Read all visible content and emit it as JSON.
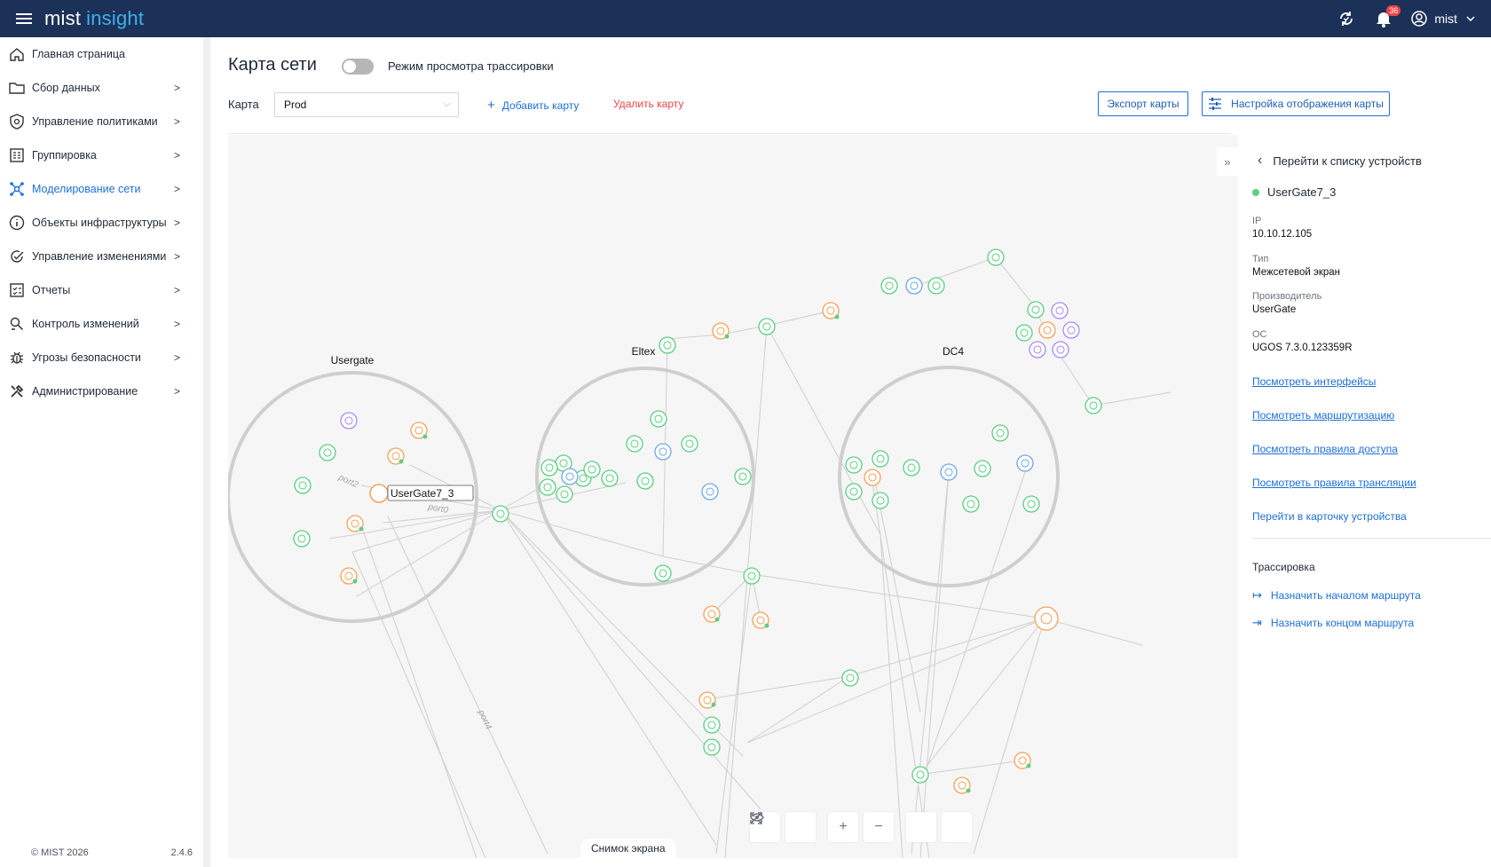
{
  "app": {
    "logo_main": "mist",
    "logo_accent": "insight",
    "notifications_count": "36",
    "user_name": "mist"
  },
  "sidebar": {
    "items": [
      {
        "label": "Главная страница",
        "icon": "home-icon",
        "chevron": ""
      },
      {
        "label": "Сбор данных",
        "icon": "folder-icon",
        "chevron": ">"
      },
      {
        "label": "Управление политиками",
        "icon": "shield-icon",
        "chevron": ">"
      },
      {
        "label": "Группировка",
        "icon": "grouping-icon",
        "chevron": ">"
      },
      {
        "label": "Моделирование сети",
        "icon": "network-icon",
        "chevron": ">"
      },
      {
        "label": "Объекты инфраструктуры",
        "icon": "info-icon",
        "chevron": ">"
      },
      {
        "label": "Управление изменениями",
        "icon": "check-circle-icon",
        "chevron": ">"
      },
      {
        "label": "Отчеты",
        "icon": "report-icon",
        "chevron": ">"
      },
      {
        "label": "Контроль изменений",
        "icon": "control-icon",
        "chevron": ">"
      },
      {
        "label": "Угрозы безопасности",
        "icon": "bug-icon",
        "chevron": ">"
      },
      {
        "label": "Администрирование",
        "icon": "tools-icon",
        "chevron": ">"
      }
    ],
    "copyright": "© MIST 2026",
    "version": "2.4.6"
  },
  "header": {
    "title": "Карта сети",
    "trace_toggle_label": "Режим просмотра трассировки",
    "map_label": "Карта",
    "map_selected": "Prod",
    "add_map": "Добавить карту",
    "delete_map": "Удалить карту",
    "export_map": "Экспорт карты",
    "map_settings": "Настройка отображения карты"
  },
  "map": {
    "groups": [
      "Usergate",
      "Eltex",
      "DC4"
    ],
    "selected_node_label": "UserGate7_3",
    "port_labels": [
      "port2",
      "port0",
      "port4"
    ],
    "screenshot_button": "Снимок экрана"
  },
  "panel": {
    "back_label": "Перейти к списку устройств",
    "device_name": "UserGate7_3",
    "ip_label": "IP",
    "ip_value": "10.10.12.105",
    "type_label": "Тип",
    "type_value": "Межсетевой экран",
    "vendor_label": "Производитель",
    "vendor_value": "UserGate",
    "os_label": "ОС",
    "os_value": "UGOS 7.3.0.123359R",
    "links": [
      "Посмотреть интерфейсы",
      "Посмотреть маршрутизацию",
      "Посмотреть правила доступа",
      "Посмотреть правила трансляции"
    ],
    "card_link": "Перейти в карточку устройства",
    "trace_heading": "Трассировка",
    "trace_start": "Назначить началом маршрута",
    "trace_end": "Назначить концом маршрута"
  },
  "colors": {
    "topbar": "#1c3157",
    "accent": "#1d6fd8",
    "danger": "#ef4444",
    "node_green": "#5ccf80",
    "node_orange": "#f5a05a",
    "node_purple": "#a78bfa",
    "node_blue": "#6ea8ea"
  }
}
